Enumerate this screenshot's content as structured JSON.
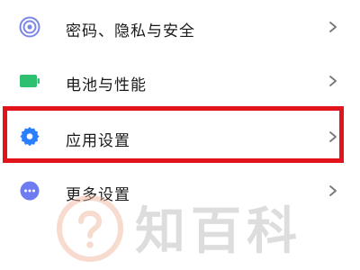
{
  "settings": {
    "items": [
      {
        "label": "密码、隐私与安全",
        "icon": "fingerprint-icon"
      },
      {
        "label": "电池与性能",
        "icon": "battery-icon"
      },
      {
        "label": "应用设置",
        "icon": "gear-icon"
      },
      {
        "label": "更多设置",
        "icon": "more-dots-icon"
      }
    ],
    "chevron_icon": "chevron-right-icon"
  },
  "watermark": {
    "text": "知百科",
    "icon": "question-mark-icon"
  },
  "colors": {
    "highlight": "#e3131b",
    "privacy_icon": "#7b87e6",
    "battery_icon": "#2fbf71",
    "gear_icon": "#2a7fff",
    "more_icon": "#6e7cf2",
    "watermark": "#f2b8a0"
  }
}
